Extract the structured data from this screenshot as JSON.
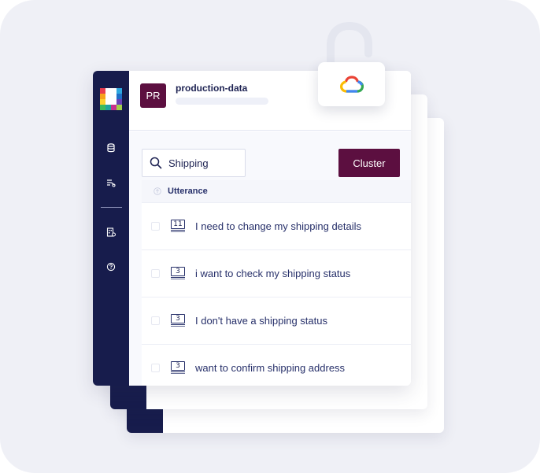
{
  "project": {
    "avatar_initials": "PR",
    "name": "production-data"
  },
  "search": {
    "value": "Shipping"
  },
  "toolbar": {
    "cluster_label": "Cluster"
  },
  "table": {
    "column_header": "Utterance",
    "rows": [
      {
        "count": "11",
        "text": "I need to change my shipping details"
      },
      {
        "count": "3",
        "text": "i want to check my shipping status"
      },
      {
        "count": "3",
        "text": "I don't have a shipping status"
      },
      {
        "count": "3",
        "text": "want to confirm shipping address"
      }
    ]
  },
  "icons": {
    "sidebar": [
      "database-icon",
      "flow-icon",
      "building-settings-icon",
      "help-icon"
    ],
    "badge": "google-cloud-icon",
    "lock": "unlocked-padlock-icon"
  },
  "colors": {
    "sidebar": "#171c4c",
    "accent": "#5c0f40",
    "text": "#27306a",
    "backdrop": "#eff0f6"
  }
}
